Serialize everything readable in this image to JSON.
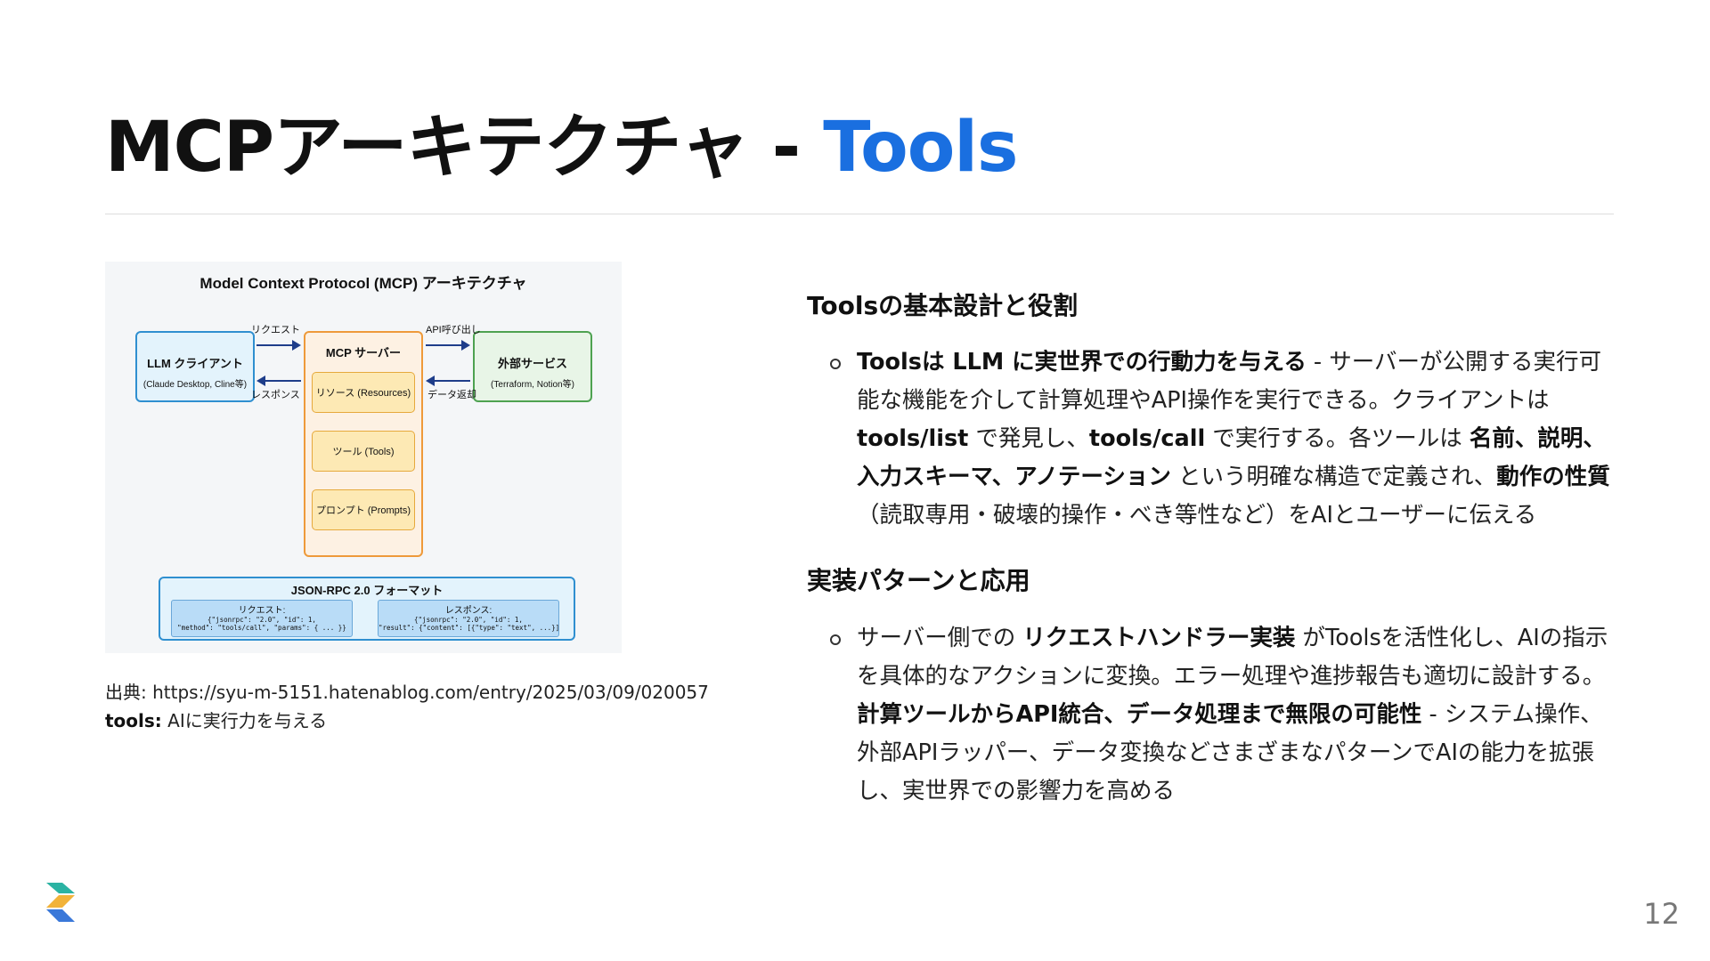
{
  "slide": {
    "title_main": "MCPアーキテクチャ - ",
    "title_accent": "Tools",
    "page_number": "12",
    "accent_color": "#1a6fe0",
    "logo_icon": "zenn-style-logo-icon"
  },
  "diagram": {
    "title": "Model Context Protocol (MCP) アーキテクチャ",
    "llm_client": {
      "name": "LLM クライアント",
      "sub": "(Claude Desktop, Cline等)"
    },
    "mcp_server": {
      "name": "MCP サーバー",
      "items": [
        "リソース (Resources)",
        "ツール (Tools)",
        "プロンプト (Prompts)"
      ]
    },
    "external": {
      "name": "外部サービス",
      "sub": "(Terraform, Notion等)"
    },
    "arrows": {
      "request": "リクエスト",
      "response": "レスポンス",
      "api_call": "API呼び出し",
      "data_return": "データ返却"
    },
    "json_rpc": {
      "title": "JSON-RPC 2.0 フォーマット",
      "request_title": "リクエスト:",
      "request_line1": "{\"jsonrpc\": \"2.0\", \"id\": 1,",
      "request_line2": "\"method\": \"tools/call\", \"params\": { ... }}",
      "response_title": "レスポンス:",
      "response_line1": "{\"jsonrpc\": \"2.0\", \"id\": 1,",
      "response_line2": "\"result\": {\"content\": [{\"type\": \"text\", ...}]}}"
    }
  },
  "caption": {
    "source_label": "出典:",
    "source_url": "https://syu-m-5151.hatenablog.com/entry/2025/03/09/020057",
    "tools_label": "tools:",
    "tools_text": "AIに実行力を与える"
  },
  "section1": {
    "heading": "Toolsの基本設計と役割",
    "b1_bold": "Toolsは LLM に実世界での行動力を与える",
    "b1_t1": " - サーバーが公開する実行可能な機能を介して計算処理やAPI操作を実行できる。クライアントは ",
    "b1_code1": "tools/list",
    "b1_t2": " で発見し、",
    "b1_code2": "tools/call",
    "b1_t3": " で実行する。各ツールは ",
    "b1_bold2": "名前、説明、入力スキーマ、アノテーション",
    "b1_t4": " という明確な構造で定義され、",
    "b1_bold3": "動作の性質",
    "b1_t5": "（読取専用・破壊的操作・べき等性など）をAIとユーザーに伝える"
  },
  "section2": {
    "heading": "実装パターンと応用",
    "b1_t1": "サーバー側での ",
    "b1_bold1": "リクエストハンドラー実装",
    "b1_t2": " がToolsを活性化し、AIの指示を具体的なアクションに変換。エラー処理や進捗報告も適切に設計する。",
    "b1_bold2": "計算ツールからAPI統合、データ処理まで無限の可能性",
    "b1_t3": " - システム操作、外部APIラッパー、データ変換などさまざまなパターンでAIの能力を拡張し、実世界での影響力を高める"
  }
}
